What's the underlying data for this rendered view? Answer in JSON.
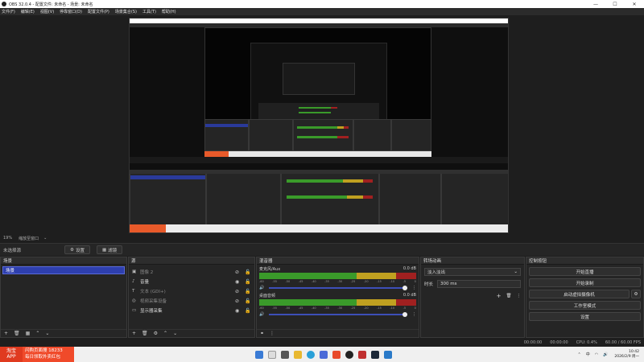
{
  "window": {
    "title": "OBS 32.0.4 - 配置文件: 未命名 - 场景: 未命名",
    "controls": [
      "—",
      "☐",
      "✕"
    ]
  },
  "menu": [
    "文件(F)",
    "编辑(E)",
    "视图(V)",
    "停靠窗口(D)",
    "配置文件(P)",
    "场景集合(S)",
    "工具(T)",
    "帮助(H)"
  ],
  "zoom": {
    "label": "19%",
    "mode": "缩放至窗口"
  },
  "context_bar": {
    "no_source": "未选择源",
    "properties": "设置",
    "filters": "滤镜"
  },
  "scenes": {
    "title": "场景",
    "items": [
      "场景"
    ]
  },
  "sources": {
    "title": "源",
    "items": [
      {
        "name": "图像 2",
        "icon": "image-icon",
        "hidden": true
      },
      {
        "name": "音量",
        "icon": "audio-icon",
        "hidden": false
      },
      {
        "name": "文本 (GDI+)",
        "icon": "text-icon",
        "hidden": true
      },
      {
        "name": "视频采集设备",
        "icon": "camera-icon",
        "hidden": true
      },
      {
        "name": "显示器采集",
        "icon": "monitor-icon",
        "hidden": false
      }
    ]
  },
  "mixer": {
    "title": "混音器",
    "channels": [
      {
        "name": "麦克风/Aux",
        "db": "0.0 dB"
      },
      {
        "name": "桌面音频",
        "db": "0.0 dB"
      }
    ],
    "scale": [
      "-60",
      "-55",
      "-50",
      "-45",
      "-40",
      "-35",
      "-30",
      "-25",
      "-20",
      "-15",
      "-10",
      "-5",
      "0"
    ]
  },
  "transitions": {
    "title": "转场动画",
    "type": "淡入淡出",
    "duration_label": "时长",
    "duration": "300 ms"
  },
  "controls": {
    "title": "控制按钮",
    "buttons": [
      "开始直播",
      "开始录制",
      "启动虚拟摄像机",
      "工作室模式",
      "设置"
    ]
  },
  "status": {
    "time1": "00:00:00",
    "time2": "00:00:00",
    "cpu": "CPU: 0.4%",
    "fps": "60.00 / 60.00 FPS"
  },
  "taskbar": {
    "ad_logo": [
      "淘宝",
      "APP"
    ],
    "ad_lines": [
      "闪购页面搜 18233",
      "每日领取外卖红包"
    ],
    "tray_lang": "中",
    "time": "10:42",
    "date": "2026/2/9 周一"
  }
}
